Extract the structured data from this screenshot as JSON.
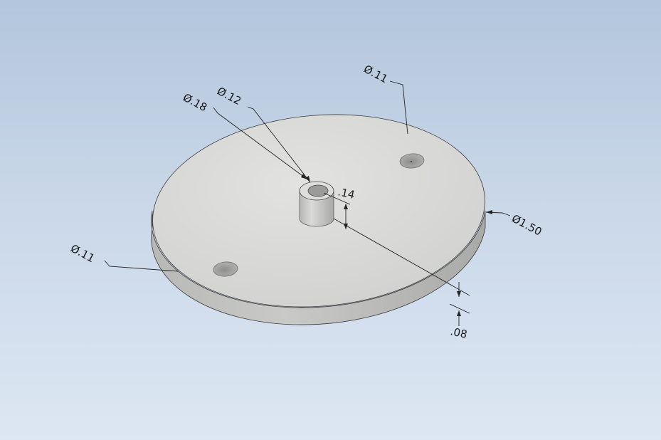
{
  "model": {
    "name": "",
    "colors": {
      "background_top": "#b3c6dd",
      "background_bottom": "#dde7f3",
      "plate_top": "#dcdcdb",
      "plate_side": "#bdbdbb",
      "boss": "#cfcfcd"
    }
  },
  "dimensions": {
    "hole_right_diameter": "Ø.11",
    "hole_left_diameter": "Ø.11",
    "boss_outer_diameter": "Ø.18",
    "boss_inner_diameter": "Ø.12",
    "boss_height": ".14",
    "plate_diameter": "Ø1.50",
    "plate_thickness": ".08"
  }
}
